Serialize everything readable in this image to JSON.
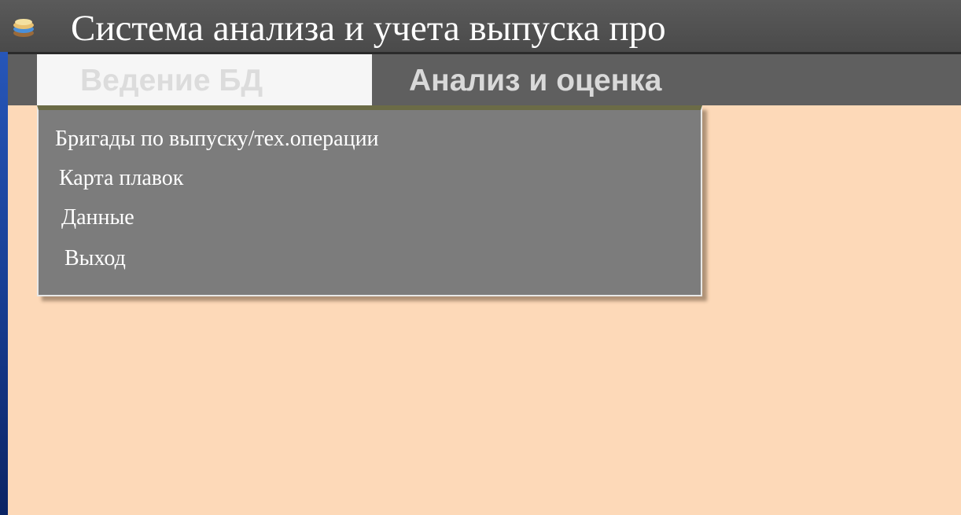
{
  "window": {
    "title": "Система анализа и учета выпуска про",
    "app_icon": "layered-database-icon"
  },
  "menu_bar": {
    "items": [
      {
        "label": "Ведение БД",
        "state": "open"
      },
      {
        "label": "Анализ и оценка",
        "state": "closed"
      }
    ]
  },
  "dropdown": {
    "items": [
      {
        "label": "Бригады по выпуску/тех.операции"
      },
      {
        "label": "Карта плавок"
      },
      {
        "label": "Данные"
      },
      {
        "label": "Выход"
      }
    ]
  },
  "colors": {
    "title_bar": "#4f4f4f",
    "menu_bar": "#5f5f5f",
    "dropdown_bg": "#7c7c7c",
    "workspace_bg": "#fdd9b8",
    "desktop_bg": "#163f9a"
  }
}
